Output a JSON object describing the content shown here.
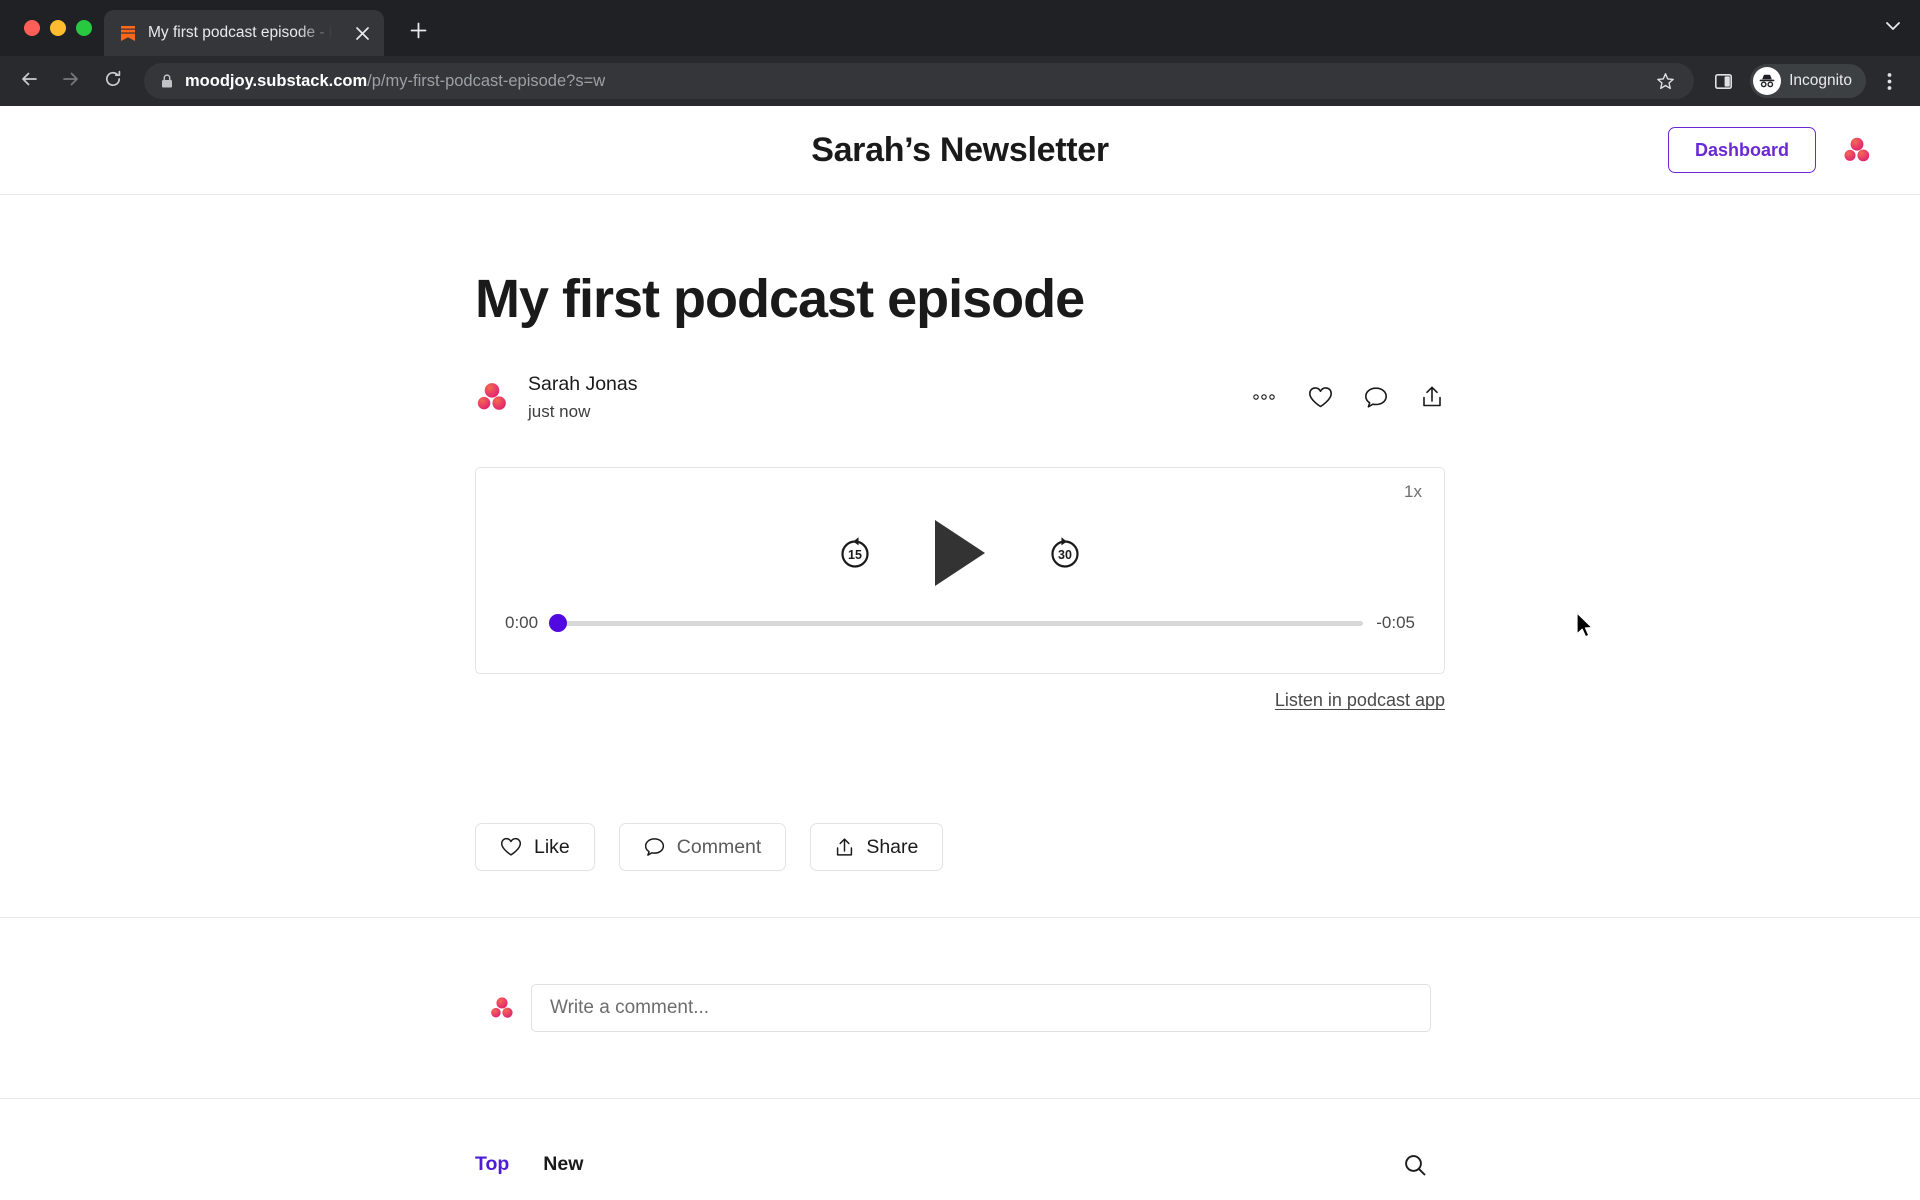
{
  "browser": {
    "tab": {
      "title": "My first podcast episode - by S",
      "favicon_icon": "substack-bookmark-icon",
      "close_icon": "close-icon"
    },
    "new_tab_icon": "plus-icon",
    "tabstrip_chevron_icon": "chevron-down-icon",
    "back_icon": "arrow-left-icon",
    "forward_icon": "arrow-right-icon",
    "reload_icon": "reload-icon",
    "lock_icon": "lock-icon",
    "url": {
      "host": "moodjoy.substack.com",
      "path": "/p/my-first-podcast-episode?s=w"
    },
    "bookmark_icon": "star-icon",
    "sidepanel_icon": "side-panel-icon",
    "profile": {
      "label": "Incognito",
      "icon": "incognito-icon"
    },
    "menu_icon": "kebab-menu-icon"
  },
  "site": {
    "title": "Sarah’s Newsletter",
    "dashboard_label": "Dashboard",
    "logo_icon": "substack-moodjoy-logo"
  },
  "post": {
    "title": "My first podcast episode",
    "author": "Sarah Jonas",
    "timestamp": "just now",
    "author_avatar_icon": "avatar-three-dots-logo",
    "actions": [
      {
        "name": "more-options",
        "icon": "ellipsis-icon"
      },
      {
        "name": "like",
        "icon": "heart-icon"
      },
      {
        "name": "comment",
        "icon": "speech-bubble-icon"
      },
      {
        "name": "share",
        "icon": "share-upload-icon"
      }
    ]
  },
  "player": {
    "speed_label": "1x",
    "rewind_label": "15",
    "forward_label": "30",
    "play_icon": "play-triangle-icon",
    "rewind_icon": "rewind-15-icon",
    "forward_icon": "forward-30-icon",
    "current_time": "0:00",
    "remaining_time": "-0:05",
    "progress_percent": 0,
    "accent_color": "#5109e0",
    "listen_link": "Listen in podcast app"
  },
  "engagement": [
    {
      "label": "Like",
      "icon": "heart-icon"
    },
    {
      "label": "Comment",
      "icon": "speech-bubble-icon"
    },
    {
      "label": "Share",
      "icon": "share-upload-icon"
    }
  ],
  "comment_box": {
    "placeholder": "Write a comment...",
    "value": "",
    "avatar_icon": "avatar-three-dots-logo"
  },
  "sort_tabs": [
    {
      "label": "Top",
      "active": true
    },
    {
      "label": "New",
      "active": false
    }
  ],
  "sort_search_icon": "search-icon",
  "colors": {
    "brand_purple": "#6b29d4",
    "active_tab_purple": "#4f1cd6",
    "player_accent": "#5109e0",
    "logo_pink": "#e8336d"
  }
}
